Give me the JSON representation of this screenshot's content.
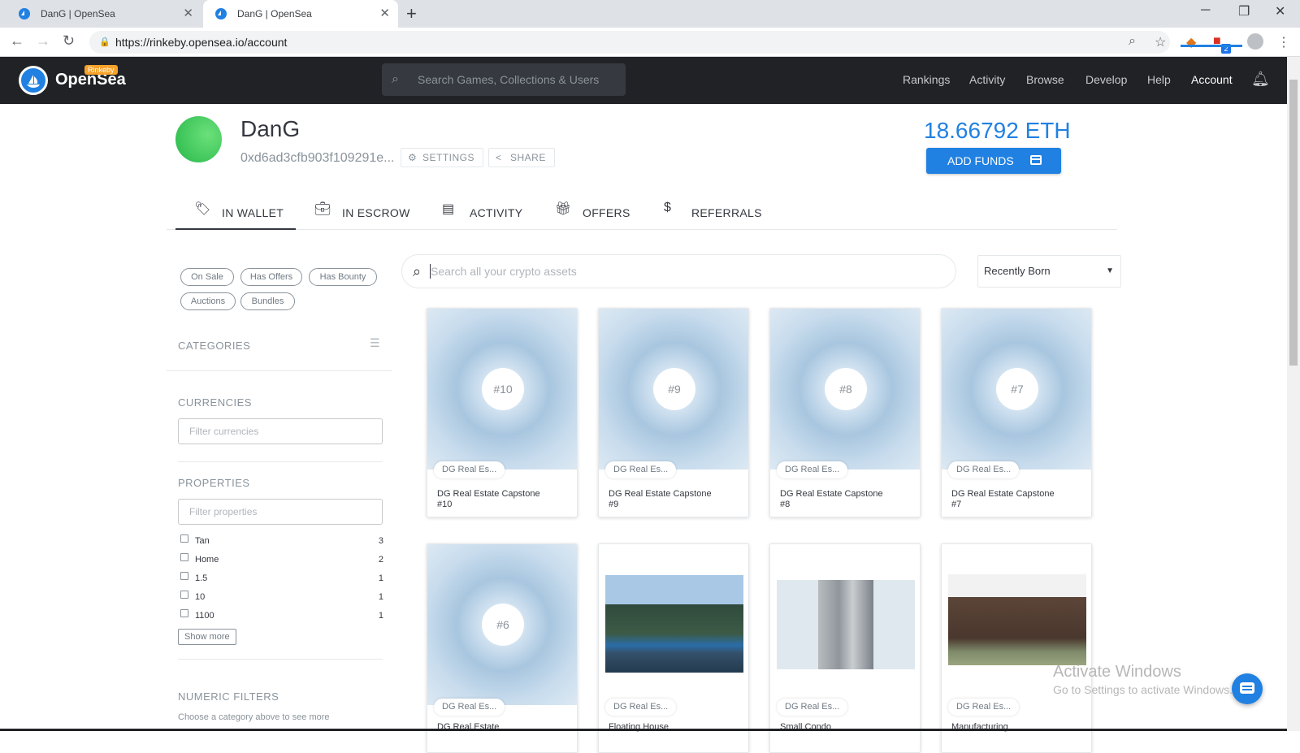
{
  "browser": {
    "tabs": [
      {
        "title": "DanG | OpenSea",
        "active": false
      },
      {
        "title": "DanG | OpenSea",
        "active": true
      }
    ],
    "new_tab_icon": "+",
    "url": "https://rinkeby.opensea.io/account",
    "window_controls": {
      "minimize": "─",
      "restore": "❐",
      "close": "✕"
    },
    "extension_badge": "2"
  },
  "nav": {
    "brand": "OpenSea",
    "network_badge": "Rinkeby",
    "search_placeholder": "Search Games, Collections & Users",
    "links": [
      "Rankings",
      "Activity",
      "Browse",
      "Develop",
      "Help",
      "Account"
    ],
    "active_link": "Account"
  },
  "profile": {
    "name": "DanG",
    "address": "0xd6ad3cfb903f109291e...",
    "settings_label": "SETTINGS",
    "share_label": "SHARE",
    "balance": "18.66792 ETH",
    "add_funds_label": "ADD FUNDS"
  },
  "tabs": [
    {
      "label": "IN WALLET",
      "icon": "tag-icon",
      "active": true
    },
    {
      "label": "IN ESCROW",
      "icon": "briefcase-icon",
      "active": false
    },
    {
      "label": "ACTIVITY",
      "icon": "chat-icon",
      "active": false
    },
    {
      "label": "OFFERS",
      "icon": "gift-icon",
      "active": false
    },
    {
      "label": "REFERRALS",
      "icon": "dollar-icon",
      "active": false
    }
  ],
  "sidebar": {
    "status_filters": [
      "On Sale",
      "Has Offers",
      "Has Bounty",
      "Auctions",
      "Bundles"
    ],
    "categories_title": "CATEGORIES",
    "currencies_title": "CURRENCIES",
    "currencies_placeholder": "Filter currencies",
    "properties_title": "PROPERTIES",
    "properties_placeholder": "Filter properties",
    "properties": [
      {
        "label": "Tan",
        "count": "3"
      },
      {
        "label": "Home",
        "count": "2"
      },
      {
        "label": "1.5",
        "count": "1"
      },
      {
        "label": "10",
        "count": "1"
      },
      {
        "label": "1100",
        "count": "1"
      }
    ],
    "show_more_label": "Show more",
    "numeric_title": "NUMERIC FILTERS",
    "numeric_hint": "Choose a category above to see more"
  },
  "main": {
    "search_placeholder": "Search all your crypto assets",
    "sort_selected": "Recently Born",
    "assets": [
      {
        "number": "#10",
        "category": "DG Real Es...",
        "title": "DG Real Estate Capstone #10"
      },
      {
        "number": "#9",
        "category": "DG Real Es...",
        "title": "DG Real Estate Capstone #9"
      },
      {
        "number": "#8",
        "category": "DG Real Es...",
        "title": "DG Real Estate Capstone #8"
      },
      {
        "number": "#7",
        "category": "DG Real Es...",
        "title": "DG Real Estate Capstone #7"
      },
      {
        "number": "#6",
        "category": "DG Real Es...",
        "title": "DG Real Estate"
      },
      {
        "number": "",
        "category": "DG Real Es...",
        "title": "Floating House"
      },
      {
        "number": "",
        "category": "DG Real Es...",
        "title": "Small Condo"
      },
      {
        "number": "",
        "category": "DG Real Es...",
        "title": "Manufacturing"
      }
    ]
  },
  "watermark": {
    "line1": "Activate Windows",
    "line2": "Go to Settings to activate Windows."
  },
  "colors": {
    "accent": "#2081e2",
    "nav_bg": "#202225",
    "avatar": "#3cc95a"
  }
}
